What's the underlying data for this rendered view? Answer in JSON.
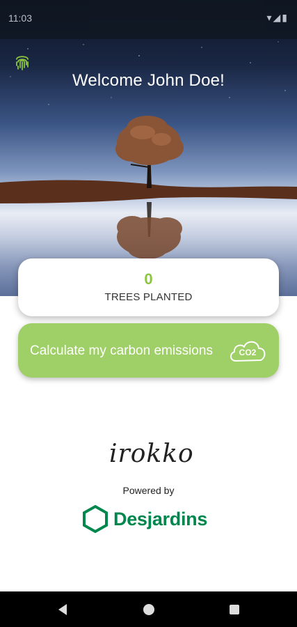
{
  "status_bar": {
    "time": "11:03",
    "right_icons": "▾◢▮"
  },
  "header": {
    "welcome": "Welcome John Doe!",
    "fingerprint_icon": "fingerprint-icon"
  },
  "trees": {
    "count": "0",
    "label": "TREES PLANTED"
  },
  "carbon": {
    "label": "Calculate my carbon emissions",
    "cloud_text": "CO2"
  },
  "branding": {
    "product_logo": "irokko",
    "powered_by": "Powered by",
    "partner_logo": "Desjardins"
  },
  "colors": {
    "accent_green": "#8cc63f",
    "button_green": "#9fcf67",
    "desjardins_green": "#00874e"
  },
  "nav": {
    "back_icon": "back-triangle-icon",
    "home_icon": "home-circle-icon",
    "recents_icon": "recents-square-icon"
  }
}
